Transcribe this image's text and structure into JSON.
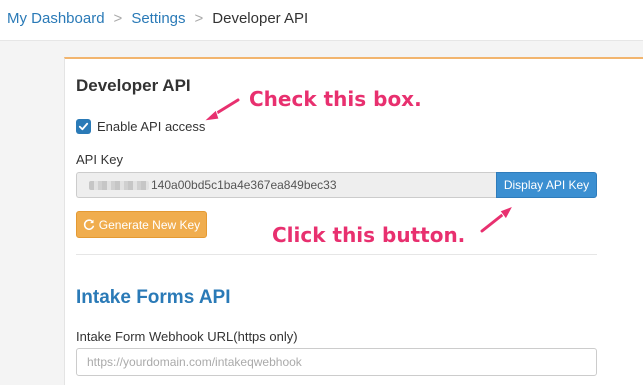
{
  "breadcrumb": {
    "items": [
      "My Dashboard",
      "Settings"
    ],
    "separator": ">",
    "current": "Developer API"
  },
  "developer_api": {
    "title": "Developer API",
    "enable_checkbox": {
      "label": "Enable API access",
      "checked": true
    },
    "api_key": {
      "label": "API Key",
      "value_visible": "140a00bd5c1ba4e367ea849bec33"
    },
    "display_button": "Display API Key",
    "generate_button": "Generate New Key"
  },
  "intake_forms": {
    "title": "Intake Forms API",
    "webhook_label": "Intake Form Webhook URL(https only)",
    "webhook_placeholder": "https://yourdomain.com/intakeqwebhook",
    "webhook_value": ""
  },
  "annotations": {
    "check_box": "Check this box.",
    "click_button": "Click this button."
  },
  "colors": {
    "link": "#2a7ab7",
    "primary_button": "#3b8fd1",
    "warning_button": "#f0ad4e",
    "panel_accent": "#f2b56e",
    "annotation": "#e8306f"
  },
  "icons": {
    "checkbox": "checkmark-icon",
    "generate": "refresh-icon"
  }
}
